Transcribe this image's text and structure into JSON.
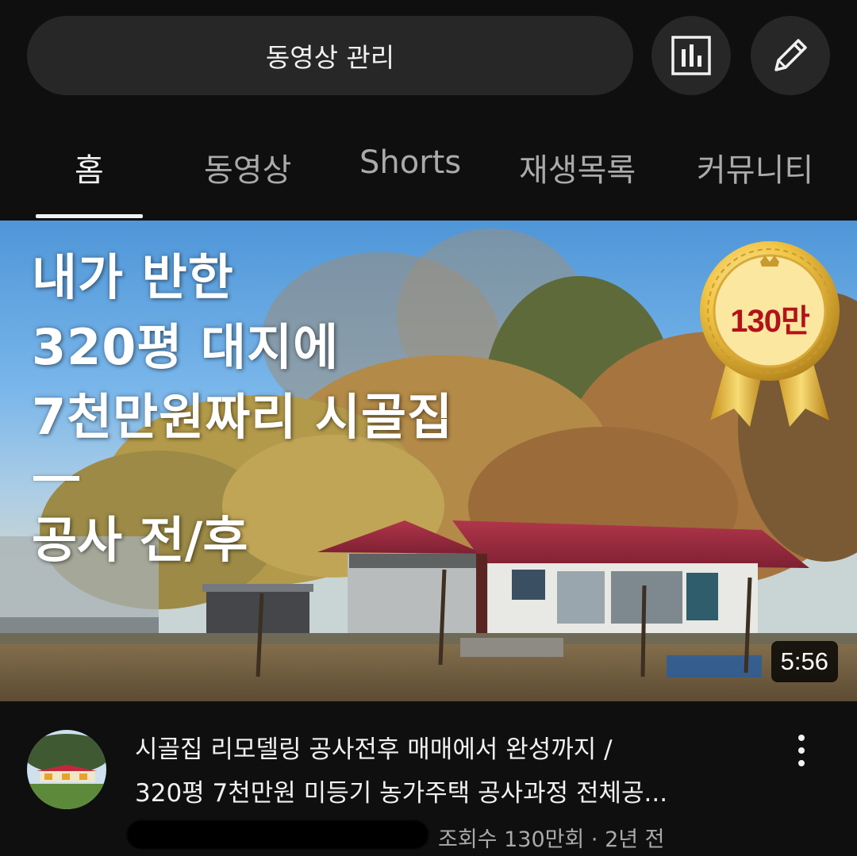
{
  "header": {
    "manage_label": "동영상 관리",
    "analytics_icon": "analytics-icon",
    "edit_icon": "pencil-icon"
  },
  "tabs": [
    {
      "label": "홈",
      "active": true
    },
    {
      "label": "동영상",
      "active": false
    },
    {
      "label": "Shorts",
      "active": false
    },
    {
      "label": "재생목록",
      "active": false
    },
    {
      "label": "커뮤니티",
      "active": false
    }
  ],
  "thumbnail": {
    "title_lines": [
      "내가 반한",
      "320평 대지에",
      "7천만원짜리 시골집"
    ],
    "subtitle": "공사 전/후",
    "badge_text": "130만",
    "duration": "5:56"
  },
  "video": {
    "title_line1": "시골집 리모델링 공사전후 매매에서 완성까지 /",
    "title_line2": "320평 7천만원 미등기 농가주택 공사과정 전체공...",
    "stats": "조회수 130만회 · 2년 전",
    "more_icon": "more-vert-icon"
  }
}
